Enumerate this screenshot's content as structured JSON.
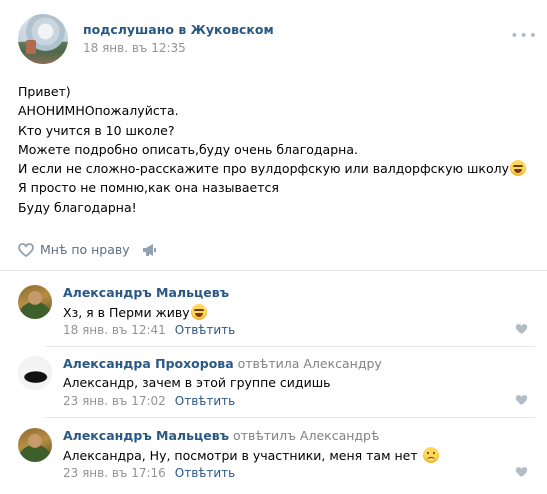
{
  "post": {
    "group_name": "подслушано в Жуковском",
    "time": "18 янв. въ 12:35",
    "more_icon": "more-dots-icon",
    "lines": [
      "Привет)",
      "АНОНИМНОпожалуйста.",
      "Кто учится в 10 школе?",
      "Можете подробно описать,буду очень благодарна.",
      "И если не сложно-расскажите про вулдорфскую или валдорфскую школу",
      "Я просто не помню,как она называется",
      "Буду благодарна!"
    ],
    "like_label": "Мнѣ по нраву",
    "like_icon": "heart-icon",
    "share_icon": "megaphone-icon"
  },
  "comments": [
    {
      "author": "Александръ Мальцевъ",
      "reply_to": "",
      "text": "Хз, я в Перми живу",
      "time": "18 янв. въ 12:41",
      "reply_label": "Отвѣтить",
      "emoji": "laugh"
    },
    {
      "author": "Александра Прохорова",
      "reply_to": "отвѣтила Александру",
      "text": "Александр, зачем в этой группе сидишь",
      "time": "23 янв. въ 17:02",
      "reply_label": "Отвѣтить",
      "emoji": ""
    },
    {
      "author": "Александръ Мальцевъ",
      "reply_to": "отвѣтилъ Александрѣ",
      "text": "Александра, Ну, посмотри в участники, меня там нет",
      "time": "23 янв. въ 17:16",
      "reply_label": "Отвѣтить",
      "emoji": "sad"
    }
  ],
  "colors": {
    "link": "#2a5885",
    "meta": "#939393",
    "action": "#5d6f85",
    "divider": "#e7e8ec"
  }
}
